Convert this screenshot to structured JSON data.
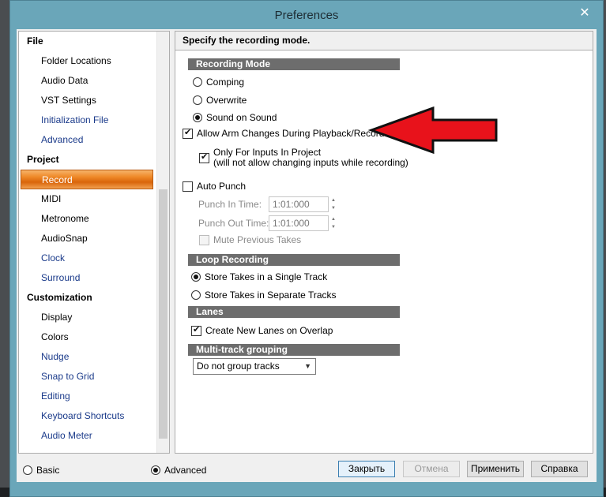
{
  "window": {
    "title": "Preferences",
    "close_glyph": "✕"
  },
  "tree": {
    "items": [
      {
        "label": "File",
        "type": "category"
      },
      {
        "label": "Folder Locations",
        "type": "item"
      },
      {
        "label": "Audio Data",
        "type": "item"
      },
      {
        "label": "VST Settings",
        "type": "item"
      },
      {
        "label": "Initialization File",
        "type": "item",
        "color": "blue"
      },
      {
        "label": "Advanced",
        "type": "item",
        "color": "blue"
      },
      {
        "label": "Project",
        "type": "category"
      },
      {
        "label": "Record",
        "type": "item",
        "selected": true
      },
      {
        "label": "MIDI",
        "type": "item"
      },
      {
        "label": "Metronome",
        "type": "item"
      },
      {
        "label": "AudioSnap",
        "type": "item"
      },
      {
        "label": "Clock",
        "type": "item",
        "color": "blue"
      },
      {
        "label": "Surround",
        "type": "item",
        "color": "blue"
      },
      {
        "label": "Customization",
        "type": "category"
      },
      {
        "label": "Display",
        "type": "item"
      },
      {
        "label": "Colors",
        "type": "item"
      },
      {
        "label": "Nudge",
        "type": "item",
        "color": "blue"
      },
      {
        "label": "Snap to Grid",
        "type": "item",
        "color": "blue"
      },
      {
        "label": "Editing",
        "type": "item",
        "color": "blue"
      },
      {
        "label": "Keyboard Shortcuts",
        "type": "item",
        "color": "blue"
      },
      {
        "label": "Audio Meter",
        "type": "item",
        "color": "blue"
      }
    ]
  },
  "panel": {
    "header": "Specify the recording mode.",
    "recording_mode": {
      "title": "Recording Mode",
      "options": [
        "Comping",
        "Overwrite",
        "Sound on Sound"
      ],
      "selected": "Sound on Sound"
    },
    "allow_arm_changes": {
      "label": "Allow Arm Changes During Playback/Record",
      "checked": true
    },
    "only_for_inputs": {
      "label": "Only For Inputs In Project",
      "sublabel": "(will not allow changing inputs while recording)",
      "checked": true
    },
    "auto_punch": {
      "label": "Auto Punch",
      "checked": false,
      "punch_in_label": "Punch In Time:",
      "punch_in_value": "1:01:000",
      "punch_out_label": "Punch Out Time:",
      "punch_out_value": "1:01:000",
      "mute_previous_label": "Mute Previous Takes"
    },
    "loop_recording": {
      "title": "Loop Recording",
      "options": [
        "Store Takes in a Single Track",
        "Store Takes in Separate Tracks"
      ],
      "selected": "Store Takes in a Single Track"
    },
    "lanes": {
      "title": "Lanes",
      "create_new_lanes": {
        "label": "Create New Lanes on Overlap",
        "checked": true
      }
    },
    "multitrack": {
      "title": "Multi-track grouping",
      "value": "Do not group tracks"
    }
  },
  "footer": {
    "basic_label": "Basic",
    "advanced_label": "Advanced",
    "view_selected": "Advanced",
    "buttons": {
      "close": "Закрыть",
      "cancel": "Отмена",
      "apply": "Применить",
      "help": "Справка"
    }
  },
  "colors": {
    "title_bar": "#6aa6b9",
    "selection": "#ef8a2a",
    "section_bar": "#6d6d6d",
    "annotation_arrow": "#e8121b"
  }
}
